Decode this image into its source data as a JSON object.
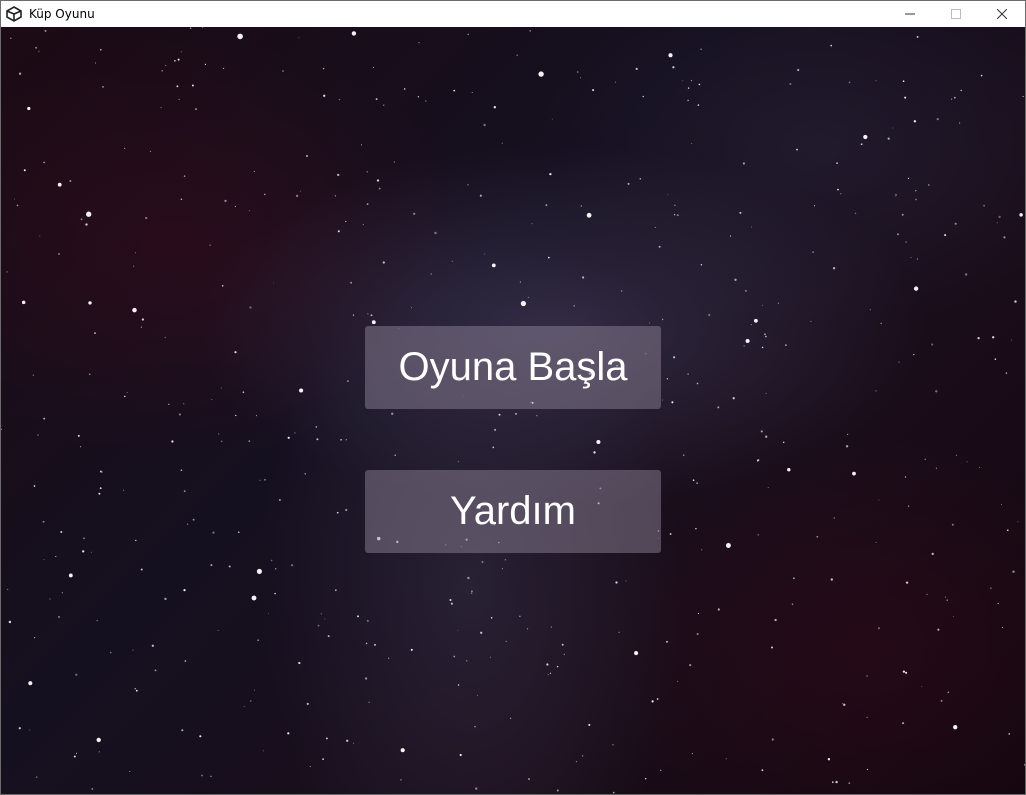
{
  "window": {
    "title": "Küp Oyunu",
    "icon": "unity-icon",
    "controls": [
      "minimize-icon",
      "maximize-icon",
      "close-icon"
    ]
  },
  "menu": {
    "start_label": "Oyuna Başla",
    "help_label": "Yardım"
  },
  "colors": {
    "button_fill": "#968ca0",
    "button_text": "#ffffff",
    "background": "#1a0d1a"
  }
}
